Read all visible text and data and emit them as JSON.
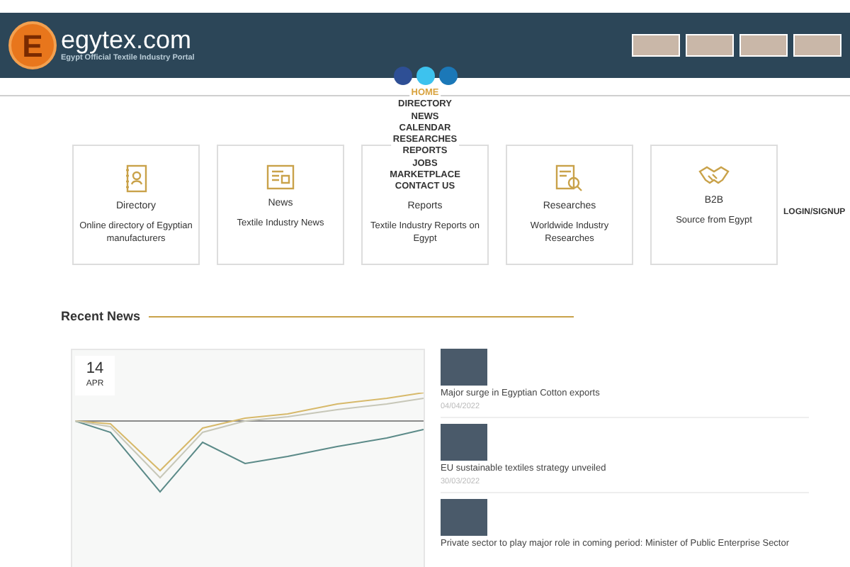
{
  "header": {
    "logo_mark": "E",
    "site_name": "egytex.com",
    "tagline": "Egypt Official Textile Industry Portal"
  },
  "social": [
    {
      "color": "#2e4f95"
    },
    {
      "color": "#3dc2ee"
    },
    {
      "color": "#1b78b8"
    }
  ],
  "nav": [
    {
      "label": "HOME",
      "selected": true
    },
    {
      "label": "DIRECTORY",
      "selected": false
    },
    {
      "label": "NEWS",
      "selected": false
    },
    {
      "label": "CALENDAR",
      "selected": false
    },
    {
      "label": "RESEARCHES",
      "selected": false
    },
    {
      "label": "REPORTS",
      "selected": false
    },
    {
      "label": "JOBS",
      "selected": false
    },
    {
      "label": "MARKETPLACE",
      "selected": false
    },
    {
      "label": "CONTACT US",
      "selected": false
    }
  ],
  "login": "LOGIN/SIGNUP",
  "cards": [
    {
      "kind": "directory",
      "title": "Directory",
      "text": "Online directory of Egyptian manufacturers"
    },
    {
      "kind": "news",
      "title": "News",
      "text": "Textile Industry News"
    },
    {
      "kind": "reports",
      "title": "Reports",
      "text": "Textile Industry Reports on Egypt"
    },
    {
      "kind": "researches",
      "title": "Researches",
      "text": "Worldwide Industry Researches"
    },
    {
      "kind": "b2b",
      "title": "B2B",
      "text": "Source from Egypt"
    }
  ],
  "recent_news": {
    "heading": "Recent News",
    "featured": {
      "day": "14",
      "month": "APR"
    },
    "items": [
      {
        "title": "Major surge in Egyptian Cotton exports",
        "date": "04/04/2022"
      },
      {
        "title": "EU sustainable textiles strategy unveiled",
        "date": "30/03/2022"
      },
      {
        "title": "Private sector to play major role in coming period: Minister of Public Enterprise Sector"
      }
    ]
  }
}
